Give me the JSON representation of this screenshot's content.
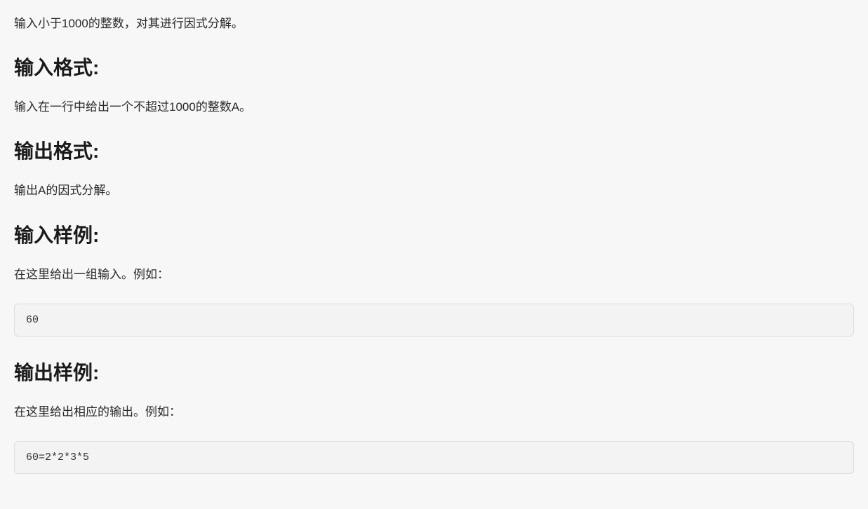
{
  "intro": "输入小于1000的整数，对其进行因式分解。",
  "input_format": {
    "heading": "输入格式:",
    "text": "输入在一行中给出一个不超过1000的整数A。"
  },
  "output_format": {
    "heading": "输出格式:",
    "text": "输出A的因式分解。"
  },
  "input_sample": {
    "heading": "输入样例:",
    "text": "在这里给出一组输入。例如：",
    "code": "60"
  },
  "output_sample": {
    "heading": "输出样例:",
    "text": "在这里给出相应的输出。例如：",
    "code": "60=2*2*3*5"
  }
}
